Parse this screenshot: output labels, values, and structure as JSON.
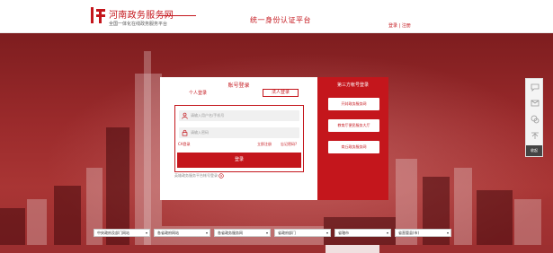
{
  "header": {
    "site_title": "河南政务服务网",
    "site_subtitle": "全国一体化在线政务服务平台",
    "platform_title": "统一身份认证平台",
    "login_link": "登录",
    "separator": "|",
    "register_link": "注册"
  },
  "login_card": {
    "heading": "账号登录",
    "tab_personal": "个人登录",
    "tab_legal": "法人登录",
    "username_placeholder": "请输入用户名/手机号",
    "password_placeholder": "请输入密码",
    "ca_login": "CA登录",
    "register_now": "立即注册",
    "forgot_password": "忘记密码?",
    "login_button": "登录",
    "help_text": "英雄政务服务平台帐号登录"
  },
  "third_party": {
    "heading": "第三方帐号登录",
    "buttons": [
      "开封政务服务网",
      "教育厅便民服务大厅",
      "商丘政务服务网"
    ]
  },
  "float_bar": {
    "close_label": "收起"
  },
  "bottom_selects": [
    {
      "label": "中央政府及部门网站"
    },
    {
      "label": "各省政府网站"
    },
    {
      "label": "各省政务服务网"
    },
    {
      "label": "省政府部门"
    },
    {
      "label": "省辖市"
    },
    {
      "label": "省直管县(市)"
    }
  ],
  "colors": {
    "brand_red": "#c4161c",
    "hero_bg": "#9a2a2b"
  }
}
